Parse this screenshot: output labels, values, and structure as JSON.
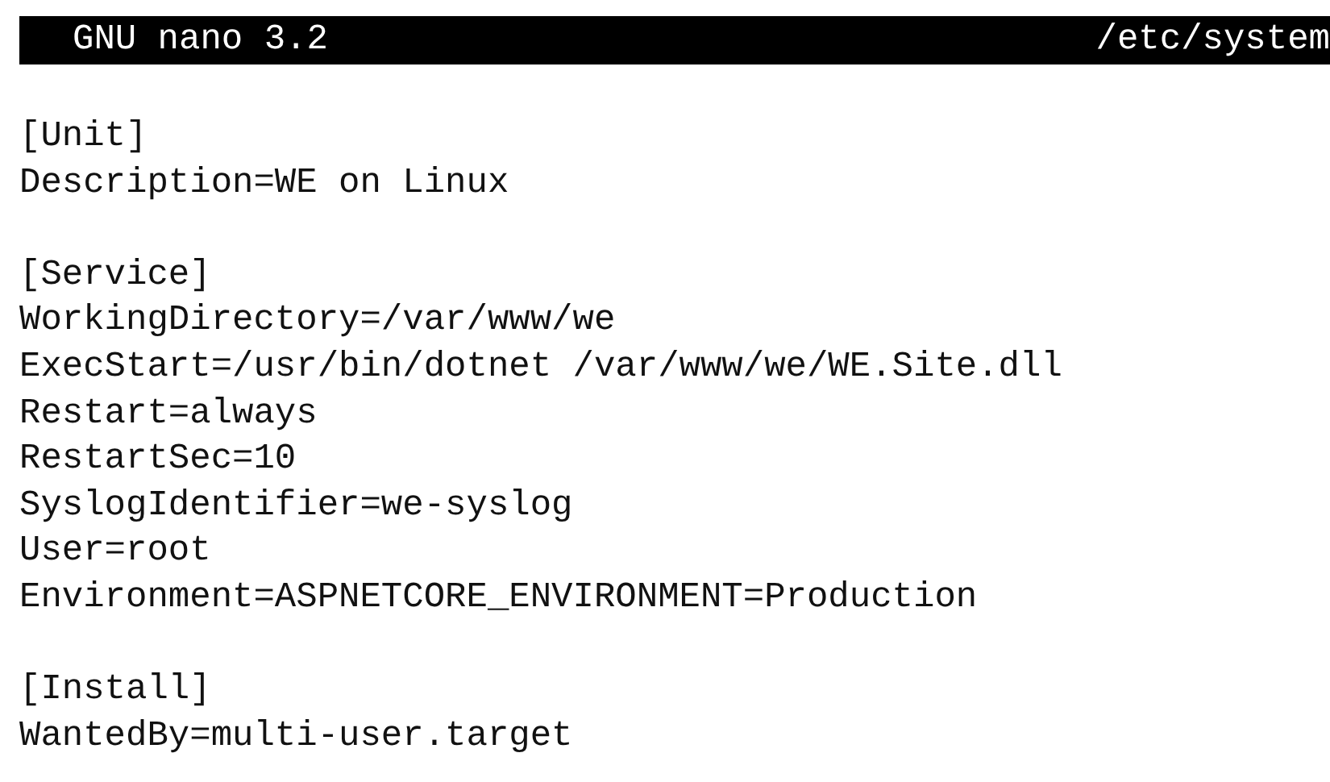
{
  "title_bar": {
    "app": "GNU nano 3.2",
    "file": "/etc/system"
  },
  "sections": [
    {
      "header": "[Unit]",
      "lines": [
        "Description=WE on Linux"
      ]
    },
    {
      "header": "[Service]",
      "lines": [
        "WorkingDirectory=/var/www/we",
        "ExecStart=/usr/bin/dotnet /var/www/we/WE.Site.dll",
        "Restart=always",
        "RestartSec=10",
        "SyslogIdentifier=we-syslog",
        "User=root",
        "Environment=ASPNETCORE_ENVIRONMENT=Production"
      ]
    },
    {
      "header": "[Install]",
      "lines": [
        "WantedBy=multi-user.target"
      ]
    }
  ]
}
